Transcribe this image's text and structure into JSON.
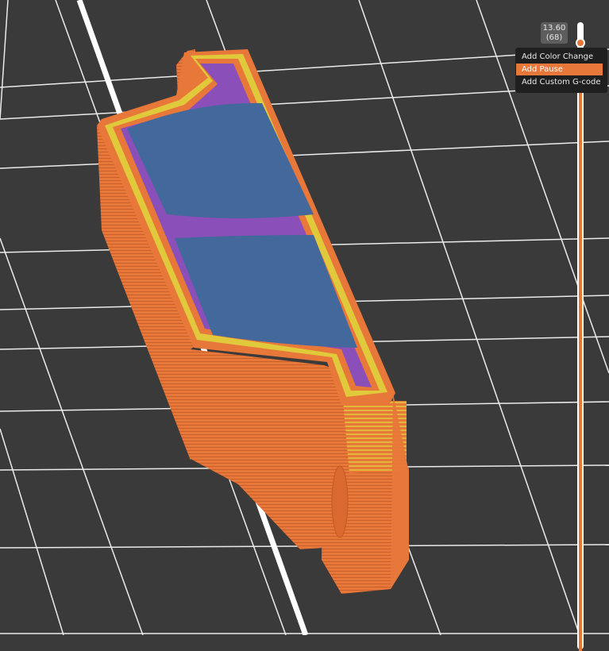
{
  "layer_slider": {
    "height_label": "13.60",
    "layer_label": "(68)",
    "accent_color": "#e8773a"
  },
  "context_menu": {
    "items": [
      {
        "label": "Add Color Change"
      },
      {
        "label": "Add Pause"
      },
      {
        "label": "Add Custom G-code"
      }
    ],
    "highlighted_index": 1
  },
  "colors": {
    "perimeter": "#e8773a",
    "external_perimeter": "#e0c93a",
    "solid_infill": "#8a4fb8",
    "top_infill": "#43689c",
    "bed_background": "#3a3a3a",
    "grid_line": "#ffffff"
  }
}
